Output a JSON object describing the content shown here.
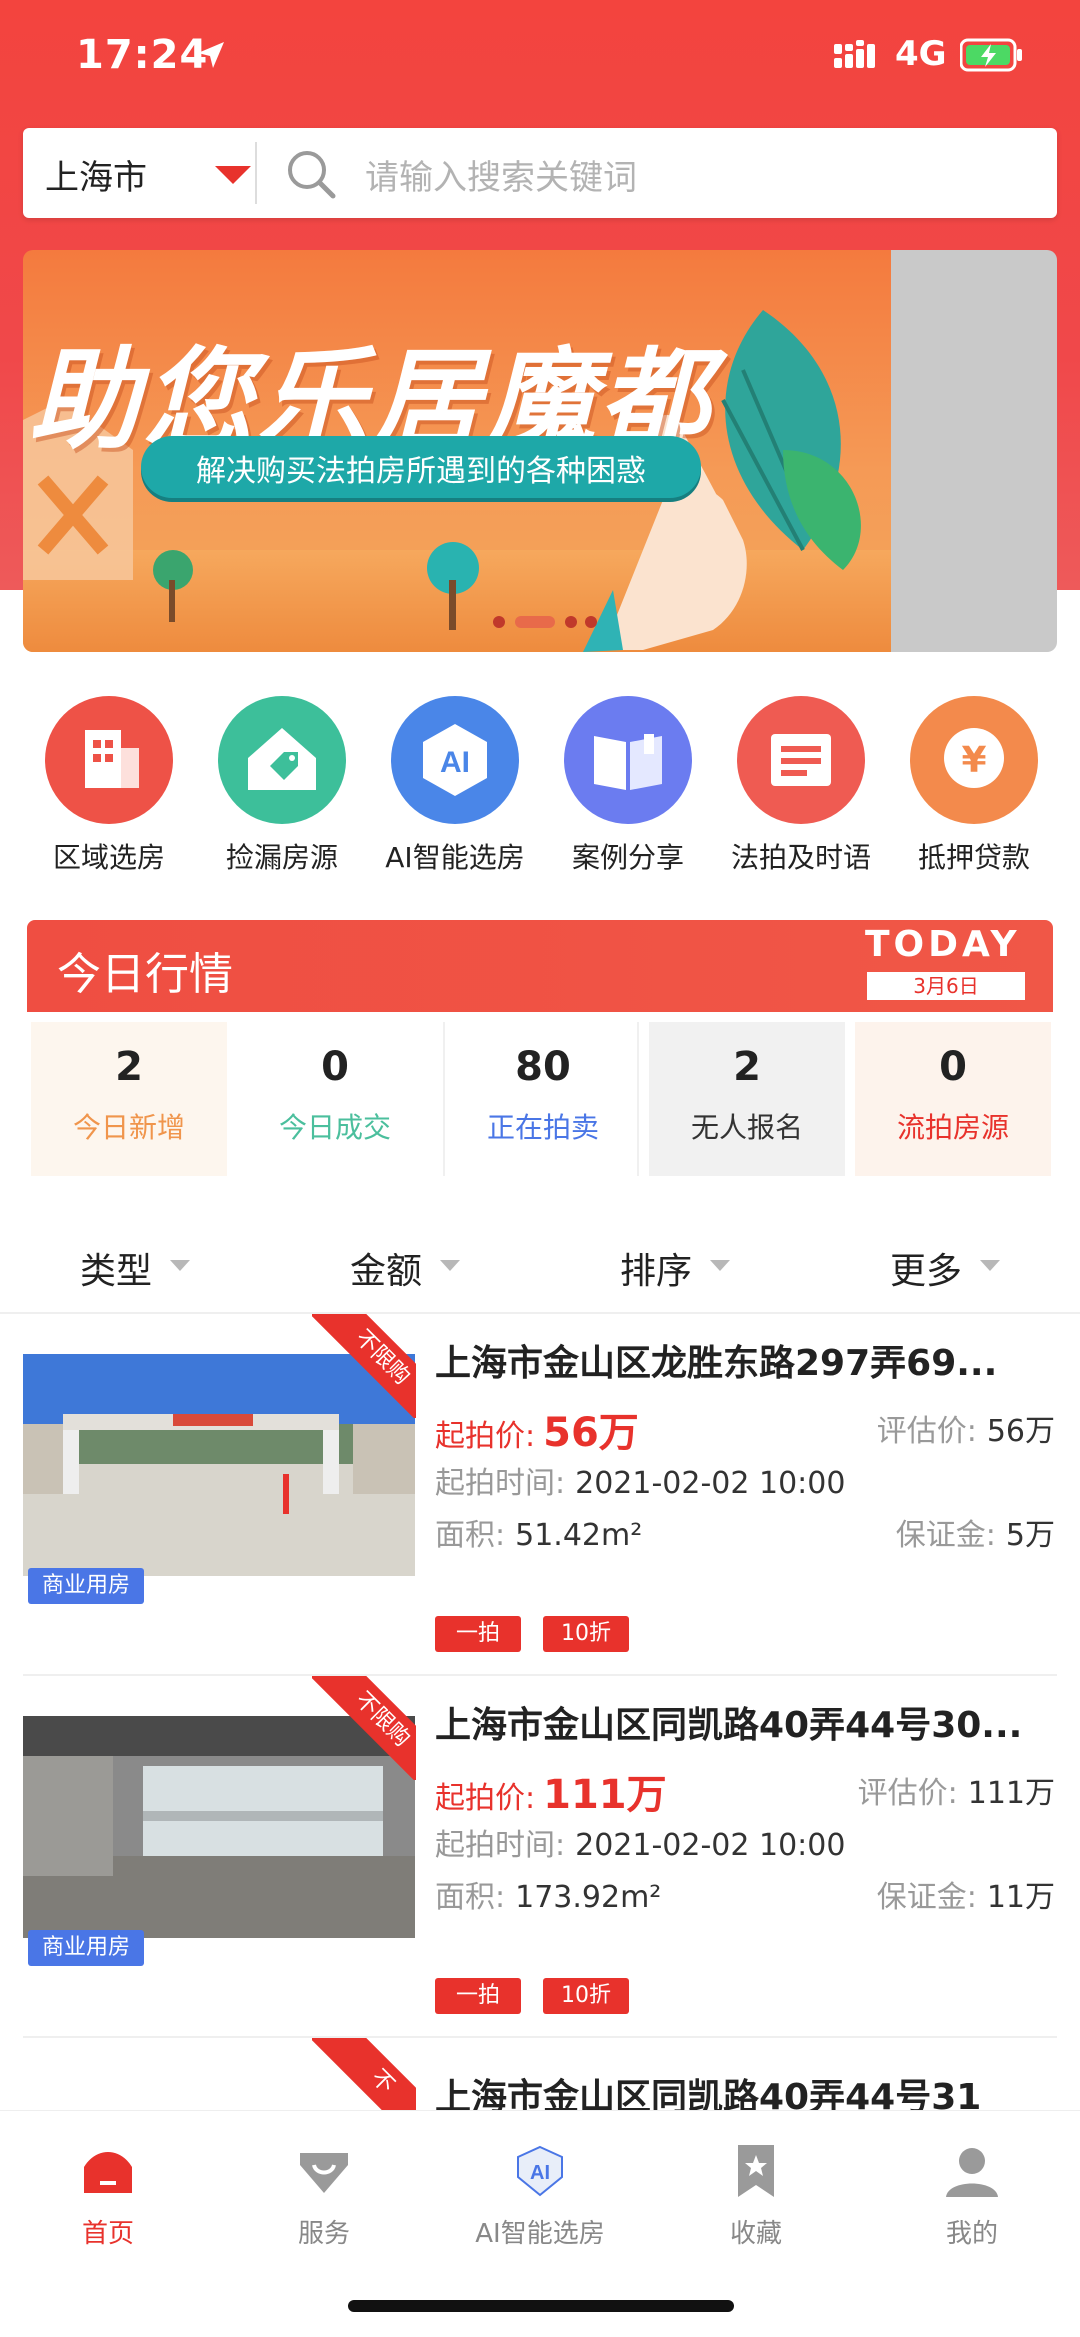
{
  "status_bar": {
    "time": "17:24",
    "network": "4G"
  },
  "search": {
    "city": "上海市",
    "placeholder": "请输入搜索关键词"
  },
  "banner": {
    "title": "助您乐居魔都",
    "subtitle": "解决购买法拍房所遇到的各种困惑"
  },
  "quick_menu": [
    {
      "label": "区域选房",
      "icon": "building-icon",
      "color": "#ee5247"
    },
    {
      "label": "捡漏房源",
      "icon": "house-tag-icon",
      "color": "#3dbf9a"
    },
    {
      "label": "AI智能选房",
      "icon": "ai-icon",
      "color": "#4a86e8"
    },
    {
      "label": "案例分享",
      "icon": "book-icon",
      "color": "#6b7cf0"
    },
    {
      "label": "法拍及时语",
      "icon": "news-icon",
      "color": "#ef5b52"
    },
    {
      "label": "抵押贷款",
      "icon": "yuan-icon",
      "color": "#f38a4c"
    }
  ],
  "today": {
    "title": "今日行情",
    "today_en": "TODAY",
    "date": "3月6日",
    "stats": [
      {
        "value": "2",
        "label": "今日新增",
        "color": "#f0954c",
        "bg": "#fdf6ee"
      },
      {
        "value": "0",
        "label": "今日成交",
        "color": "#4bbf9d",
        "bg": "#ffffff"
      },
      {
        "value": "80",
        "label": "正在拍卖",
        "color": "#4a76e6",
        "bg": "#ffffff"
      },
      {
        "value": "2",
        "label": "无人报名",
        "color": "#333333",
        "bg": "#f1f1f1"
      },
      {
        "value": "0",
        "label": "流拍房源",
        "color": "#e8322c",
        "bg": "#fdf3ec"
      }
    ]
  },
  "filters": [
    "类型",
    "金额",
    "排序",
    "更多"
  ],
  "listings": [
    {
      "title": "上海市金山区龙胜东路297弄69...",
      "price_label": "起拍价:",
      "price": "56万",
      "appraisal_label": "评估价:",
      "appraisal": "56万",
      "time_label": "起拍时间:",
      "time": "2021-02-02 10:00",
      "area_label": "面积:",
      "area": "51.42m²",
      "deposit_label": "保证金:",
      "deposit": "5万",
      "corner_tag": "不限购",
      "type_tag": "商业用房",
      "badges": [
        "一拍",
        "10折"
      ]
    },
    {
      "title": "上海市金山区同凯路40弄44号30...",
      "price_label": "起拍价:",
      "price": "111万",
      "appraisal_label": "评估价:",
      "appraisal": "111万",
      "time_label": "起拍时间:",
      "time": "2021-02-02 10:00",
      "area_label": "面积:",
      "area": "173.92m²",
      "deposit_label": "保证金:",
      "deposit": "11万",
      "corner_tag": "不限购",
      "type_tag": "商业用房",
      "badges": [
        "一拍",
        "10折"
      ]
    },
    {
      "title": "上海市金山区同凯路40弄44号31",
      "corner_tag": "不"
    }
  ],
  "tabbar": [
    {
      "label": "首页",
      "icon": "home-icon",
      "active": true
    },
    {
      "label": "服务",
      "icon": "service-bag-icon",
      "active": false
    },
    {
      "label": "AI智能选房",
      "icon": "ai-shield-icon",
      "active": false
    },
    {
      "label": "收藏",
      "icon": "bookmark-icon",
      "active": false
    },
    {
      "label": "我的",
      "icon": "profile-icon",
      "active": false
    }
  ],
  "colors": {
    "brand_red": "#e8322c",
    "tab_active": "#e8322c",
    "tab_inactive": "#888888"
  }
}
